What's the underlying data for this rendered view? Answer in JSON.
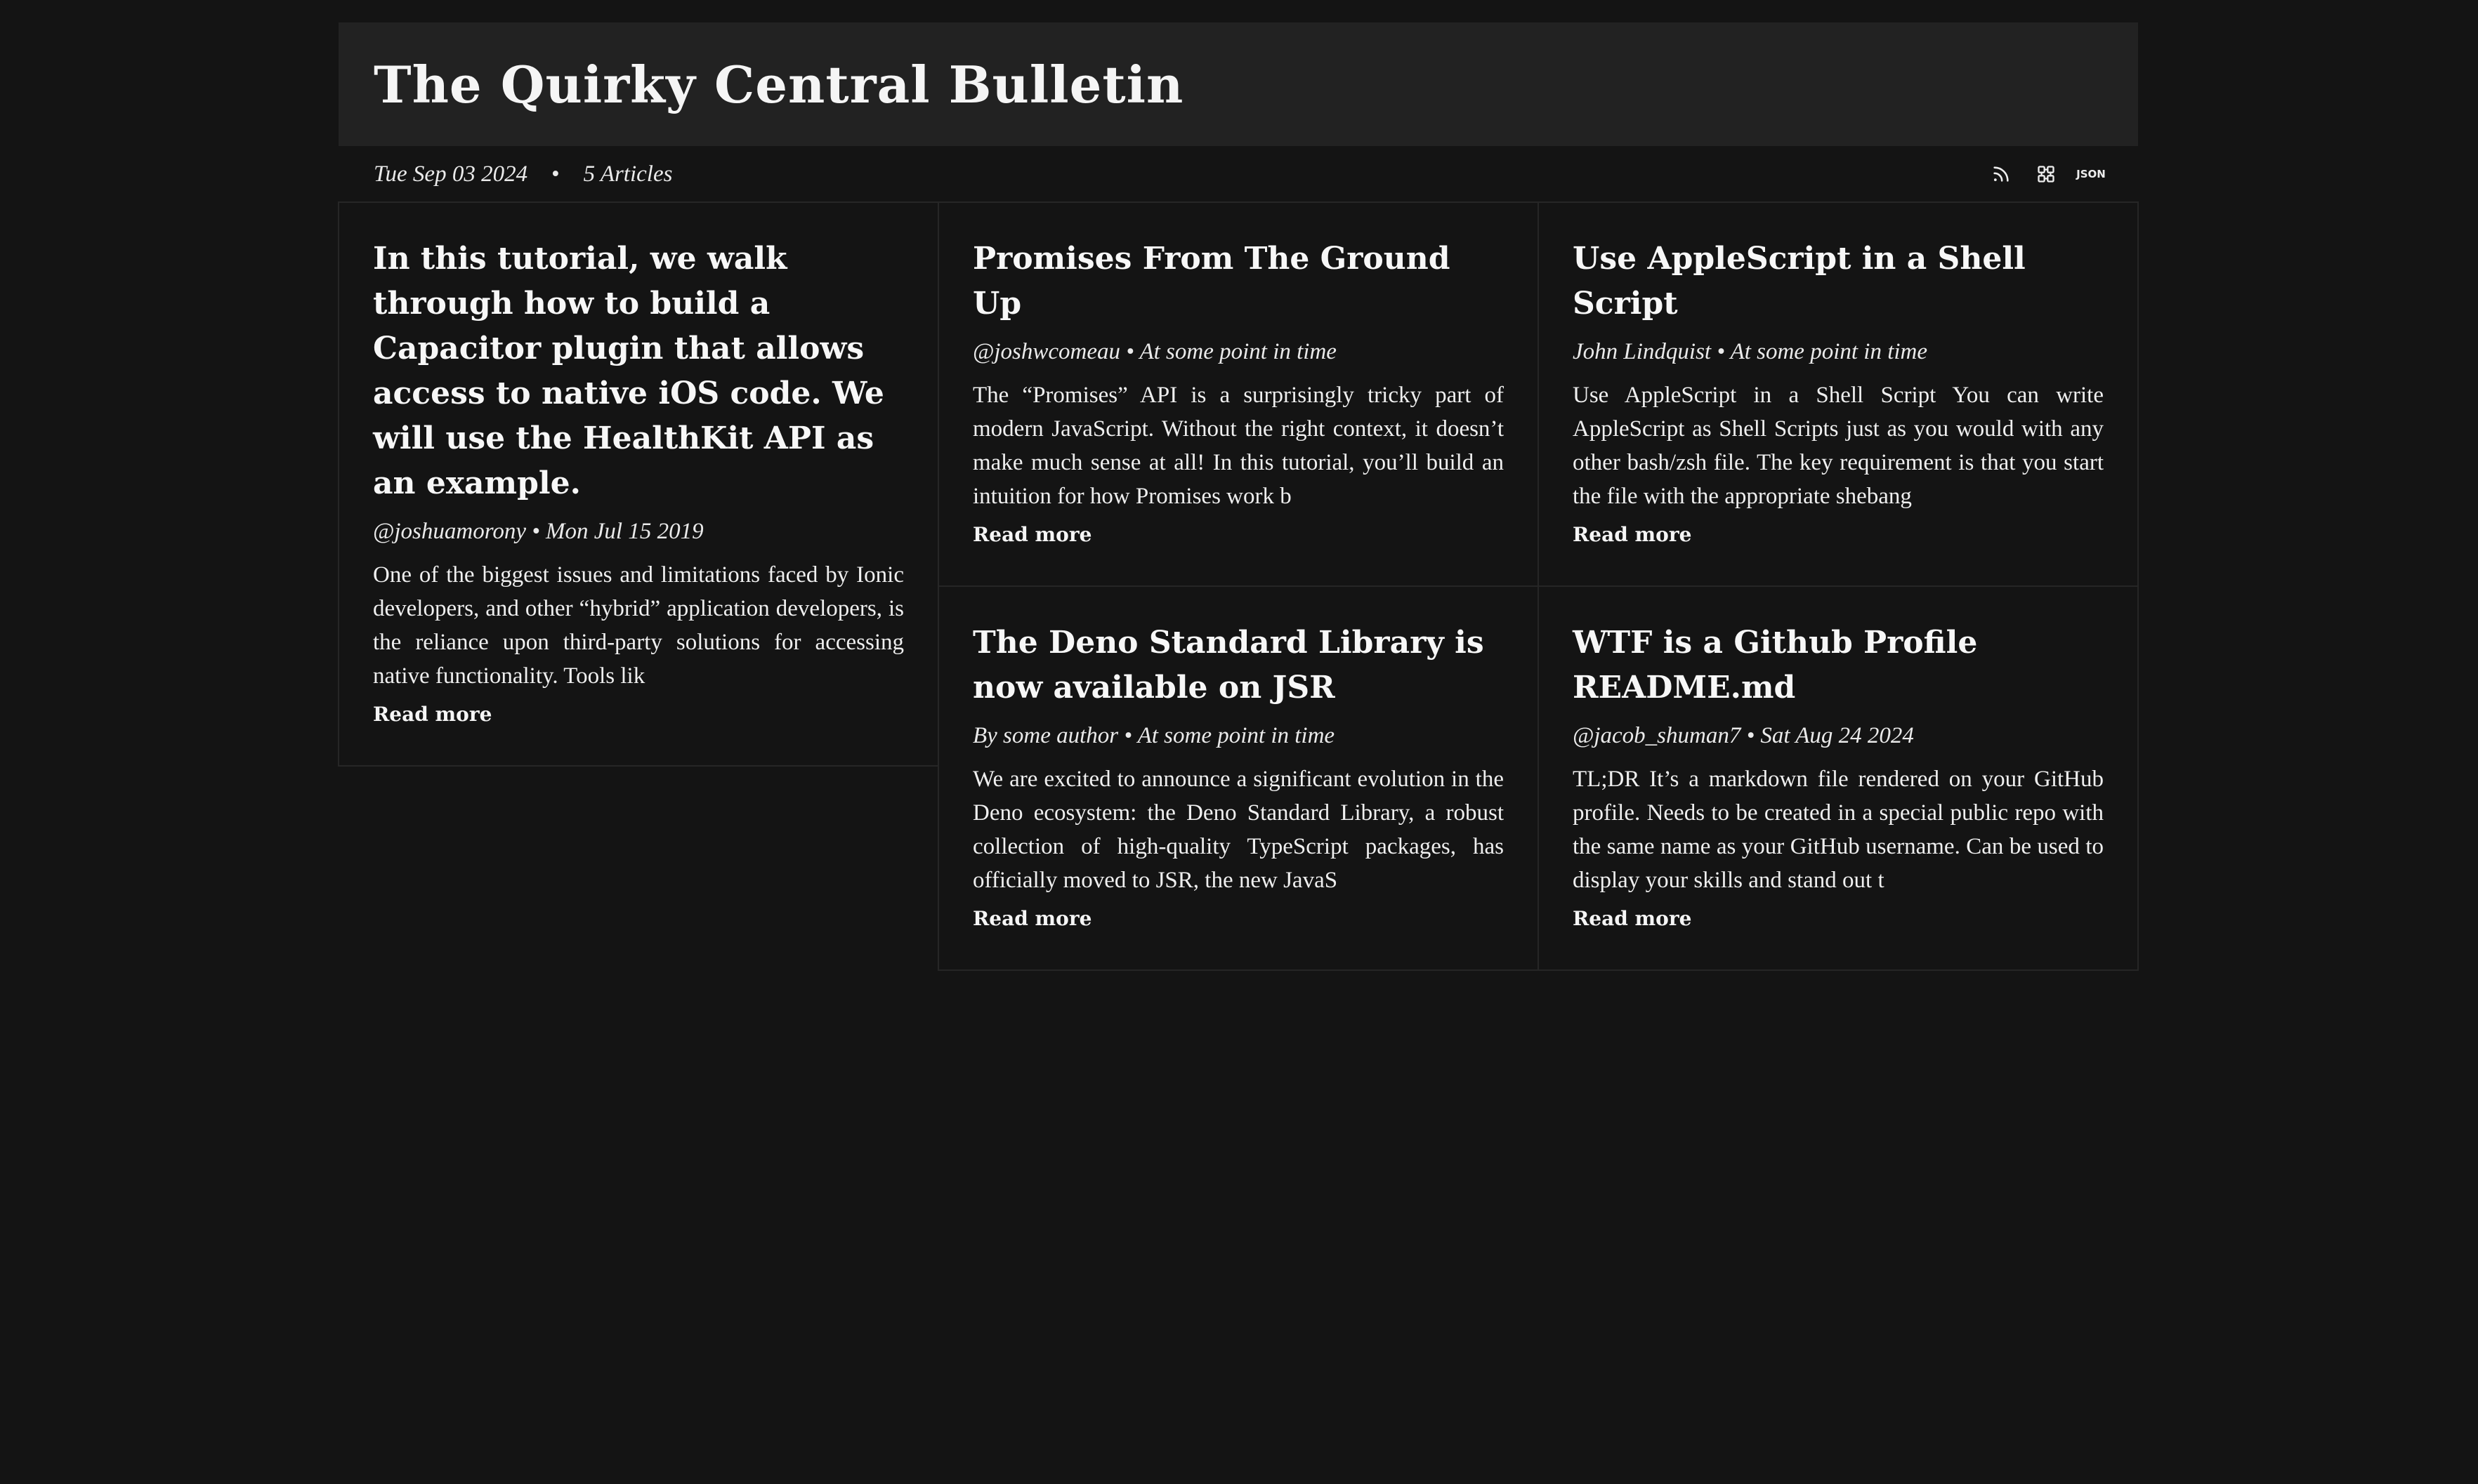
{
  "site": {
    "title": "The Quirky Central Bulletin",
    "date": "Tue Sep 03 2024",
    "separator": "•",
    "article_count": "5 Articles",
    "icons": [
      "rss-icon",
      "sitemap-icon",
      "json-feed-icon"
    ],
    "json_label": "JSON"
  },
  "columns": [
    [
      {
        "title": "In this tutorial, we walk through how to build a Capacitor plugin that allows access to native iOS code. We will use the HealthKit API as an example.",
        "byline": "@joshuamorony • Mon Jul 15 2019",
        "excerpt": "One of the biggest issues and limitations faced by Ionic developers, and other “hybrid” application developers, is the reliance upon third-party solutions for accessing native functionality. Tools lik",
        "read_more": "Read more"
      }
    ],
    [
      {
        "title": "Promises From The Ground Up",
        "byline": "@joshwcomeau • At some point in time",
        "excerpt": "The “Promises” API is a surprisingly tricky part of modern JavaScript. Without the right context, it doesn’t make much sense at all! In this tutorial, you’ll build an intuition for how Promises work b",
        "read_more": "Read more"
      },
      {
        "title": "The Deno Standard Library is now available on JSR",
        "byline": "By some author • At some point in time",
        "excerpt": "We are excited to announce a significant evolution in the Deno ecosystem: the Deno Standard Library, a robust collection of high-quality TypeScript packages, has officially moved to JSR, the new JavaS",
        "read_more": "Read more"
      }
    ],
    [
      {
        "title": "Use AppleScript in a Shell Script",
        "byline": "John Lindquist • At some point in time",
        "excerpt": "Use AppleScript in a Shell Script You can write AppleScript as Shell Scripts just as you would with any other bash/zsh file. The key requirement is that you start the file with the appropriate shebang",
        "read_more": "Read more"
      },
      {
        "title": "WTF is a Github Profile README.md",
        "byline": "@jacob_shuman7 • Sat Aug 24 2024",
        "excerpt": "TL;DR It’s a markdown file rendered on your GitHub profile. Needs to be created in a special public repo with the same name as your GitHub username. Can be used to display your skills and stand out t",
        "read_more": "Read more"
      }
    ]
  ]
}
